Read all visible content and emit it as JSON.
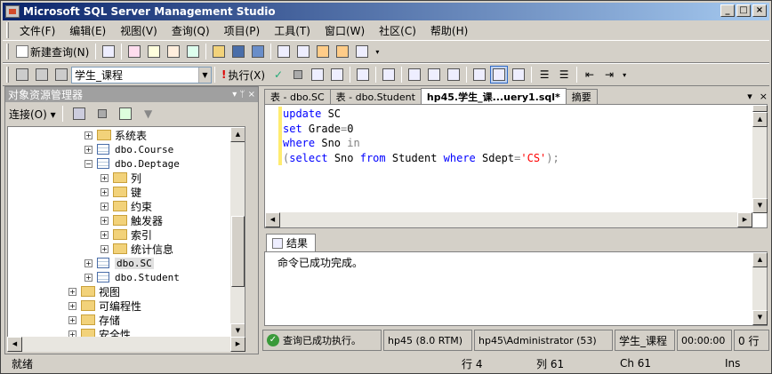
{
  "window": {
    "title": "Microsoft SQL Server Management Studio"
  },
  "menu": [
    "文件(F)",
    "编辑(E)",
    "视图(V)",
    "查询(Q)",
    "项目(P)",
    "工具(T)",
    "窗口(W)",
    "社区(C)",
    "帮助(H)"
  ],
  "toolbar1": {
    "new_query": "新建查询(N)"
  },
  "toolbar2": {
    "database": "学生_课程",
    "execute": "执行(X)"
  },
  "object_explorer": {
    "title": "对象资源管理器",
    "connect": "连接(O) ▾",
    "tree": [
      {
        "label": "系统表",
        "indent": 4,
        "kind": "folder",
        "exp": "+"
      },
      {
        "label": "dbo.Course",
        "indent": 4,
        "kind": "table",
        "exp": "+"
      },
      {
        "label": "dbo.Deptage",
        "indent": 4,
        "kind": "table",
        "exp": "−"
      },
      {
        "label": "列",
        "indent": 5,
        "kind": "folder",
        "exp": "+"
      },
      {
        "label": "键",
        "indent": 5,
        "kind": "folder",
        "exp": "+"
      },
      {
        "label": "约束",
        "indent": 5,
        "kind": "folder",
        "exp": "+"
      },
      {
        "label": "触发器",
        "indent": 5,
        "kind": "folder",
        "exp": "+"
      },
      {
        "label": "索引",
        "indent": 5,
        "kind": "folder",
        "exp": "+"
      },
      {
        "label": "统计信息",
        "indent": 5,
        "kind": "folder",
        "exp": "+"
      },
      {
        "label": "dbo.SC",
        "indent": 4,
        "kind": "table",
        "exp": "+"
      },
      {
        "label": "dbo.Student",
        "indent": 4,
        "kind": "table",
        "exp": "+"
      },
      {
        "label": "视图",
        "indent": 3,
        "kind": "folder",
        "exp": "+"
      },
      {
        "label": "可编程性",
        "indent": 3,
        "kind": "folder",
        "exp": "+"
      },
      {
        "label": "存储",
        "indent": 3,
        "kind": "folder",
        "exp": "+"
      },
      {
        "label": "安全性",
        "indent": 3,
        "kind": "folder",
        "exp": "+"
      }
    ]
  },
  "tabs": [
    "表 - dbo.SC",
    "表 - dbo.Student",
    "hp45.学生_课...uery1.sql*",
    "摘要"
  ],
  "editor": {
    "lines": [
      [
        {
          "t": "update",
          "c": "kw"
        },
        {
          "t": " SC",
          "c": ""
        }
      ],
      [
        {
          "t": "set",
          "c": "kw"
        },
        {
          "t": " Grade",
          "c": ""
        },
        {
          "t": "=",
          "c": "op"
        },
        {
          "t": "0",
          "c": ""
        }
      ],
      [
        {
          "t": "where",
          "c": "kw"
        },
        {
          "t": " Sno ",
          "c": ""
        },
        {
          "t": "in",
          "c": "op"
        }
      ],
      [
        {
          "t": "(",
          "c": "op"
        },
        {
          "t": "select",
          "c": "kw"
        },
        {
          "t": " Sno ",
          "c": ""
        },
        {
          "t": "from",
          "c": "kw"
        },
        {
          "t": " Student ",
          "c": ""
        },
        {
          "t": "where",
          "c": "kw"
        },
        {
          "t": " Sdept",
          "c": ""
        },
        {
          "t": "=",
          "c": "op"
        },
        {
          "t": "'CS'",
          "c": "str"
        },
        {
          "t": ");",
          "c": "op"
        }
      ]
    ]
  },
  "results": {
    "tab": "结果",
    "message": "命令已成功完成。"
  },
  "query_status": {
    "message": "查询已成功执行。",
    "server": "hp45 (8.0 RTM)",
    "user": "hp45\\Administrator (53)",
    "database": "学生_课程",
    "time": "00:00:00",
    "rows": "0 行"
  },
  "statusbar": {
    "ready": "就绪",
    "line": "行 4",
    "col": "列 61",
    "ch": "Ch 61",
    "mode": "Ins"
  }
}
